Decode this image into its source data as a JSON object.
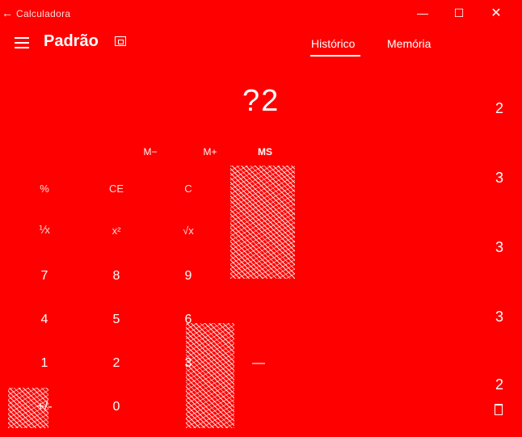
{
  "window": {
    "title": "Calculadora",
    "back_glyph": "←",
    "minimize_glyph": "—",
    "maximize_glyph": "☐",
    "close_glyph": "✕"
  },
  "header": {
    "mode": "Padrão",
    "tabs": [
      {
        "label": "Histórico",
        "active": true
      },
      {
        "label": "Memória",
        "active": false
      }
    ]
  },
  "display": {
    "value": "?2"
  },
  "memory_row": {
    "m_minus": "M−",
    "m_plus": "M+",
    "ms": "MS"
  },
  "keypad": {
    "percent": "%",
    "ce": "CE",
    "c": "C",
    "reciprocal": "⅟x",
    "square": "x²",
    "sqrt": "√x",
    "seven": "7",
    "eight": "8",
    "nine": "9",
    "four": "4",
    "five": "5",
    "six": "6",
    "one": "1",
    "two": "2",
    "three": "3",
    "negate": "+/-",
    "zero": "0",
    "minus_op": "—"
  },
  "history": {
    "values": [
      "2",
      "3",
      "3",
      "3",
      "2"
    ]
  },
  "colors": {
    "background": "#ff0000",
    "foreground": "#ffffff"
  }
}
